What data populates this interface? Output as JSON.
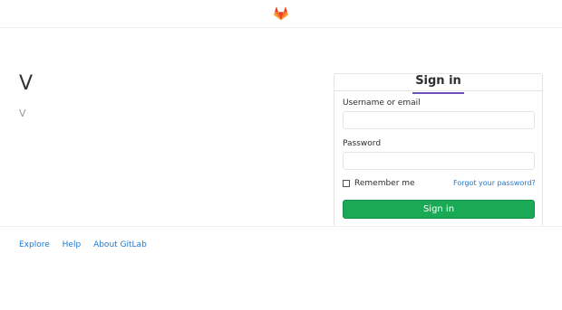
{
  "brand": {
    "title": "V",
    "description": "V"
  },
  "login": {
    "tab_label": "Sign in",
    "username_label": "Username or email",
    "username_value": "",
    "password_label": "Password",
    "password_value": "",
    "remember_label": "Remember me",
    "remember_checked": false,
    "forgot_label": "Forgot your password?",
    "submit_label": "Sign in"
  },
  "footer": {
    "links": [
      "Explore",
      "Help",
      "About GitLab"
    ]
  },
  "colors": {
    "accent_green": "#1aaa55",
    "link_blue": "#1f78d1",
    "tab_underline": "#6b4fbb",
    "logo_orange": "#fc6d26"
  },
  "icons": {
    "logo": "gitlab-tanuki-icon",
    "checkbox": "checkbox-icon"
  }
}
